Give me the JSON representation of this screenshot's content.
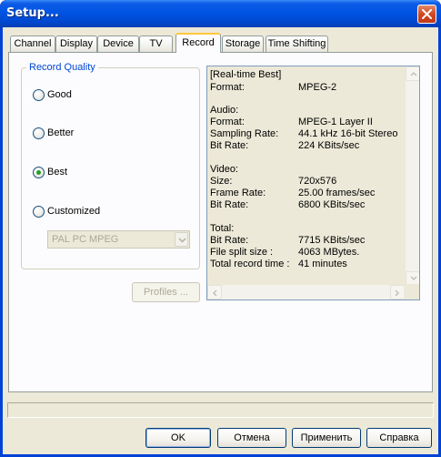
{
  "window": {
    "title": "Setup..."
  },
  "tabs": [
    {
      "label": "Channel"
    },
    {
      "label": "Display"
    },
    {
      "label": "Device"
    },
    {
      "label": "TV"
    },
    {
      "label": "Record",
      "active": true
    },
    {
      "label": "Storage"
    },
    {
      "label": "Time Shifting"
    }
  ],
  "record_quality": {
    "label": "Record Quality",
    "options": [
      {
        "label": "Good",
        "selected": false
      },
      {
        "label": "Better",
        "selected": false
      },
      {
        "label": "Best",
        "selected": true
      },
      {
        "label": "Customized",
        "selected": false
      }
    ],
    "profile_select": {
      "value": "PAL PC MPEG",
      "enabled": false
    },
    "profiles_button": {
      "label": "Profiles ...",
      "enabled": false
    }
  },
  "info": {
    "lines": [
      {
        "label": "[Real-time Best]",
        "value": ""
      },
      {
        "label": "Format:",
        "value": "MPEG-2"
      },
      {
        "label": "Audio:",
        "value": ""
      },
      {
        "label": "Format:",
        "value": "MPEG-1 Layer II"
      },
      {
        "label": "Sampling Rate:",
        "value": "44.1 kHz 16-bit Stereo"
      },
      {
        "label": "Bit Rate:",
        "value": "224 KBits/sec"
      },
      {
        "label": "Video:",
        "value": ""
      },
      {
        "label": "Size:",
        "value": "720x576"
      },
      {
        "label": "Frame Rate:",
        "value": "25.00 frames/sec"
      },
      {
        "label": "Bit Rate:",
        "value": "6800 KBits/sec"
      },
      {
        "label": "Total:",
        "value": ""
      },
      {
        "label": "Bit Rate:",
        "value": "7715 KBits/sec"
      },
      {
        "label": "File split size :",
        "value": "4063 MBytes."
      },
      {
        "label": "Total record time :",
        "value": "41 minutes"
      }
    ]
  },
  "buttons": {
    "ok": "OK",
    "cancel": "Отмена",
    "apply": "Применить",
    "help": "Справка"
  },
  "colors": {
    "titlebar": "#0054e3",
    "group_label": "#0046d5",
    "radio_dot": "#21a121",
    "close_button": "#d2481e"
  }
}
